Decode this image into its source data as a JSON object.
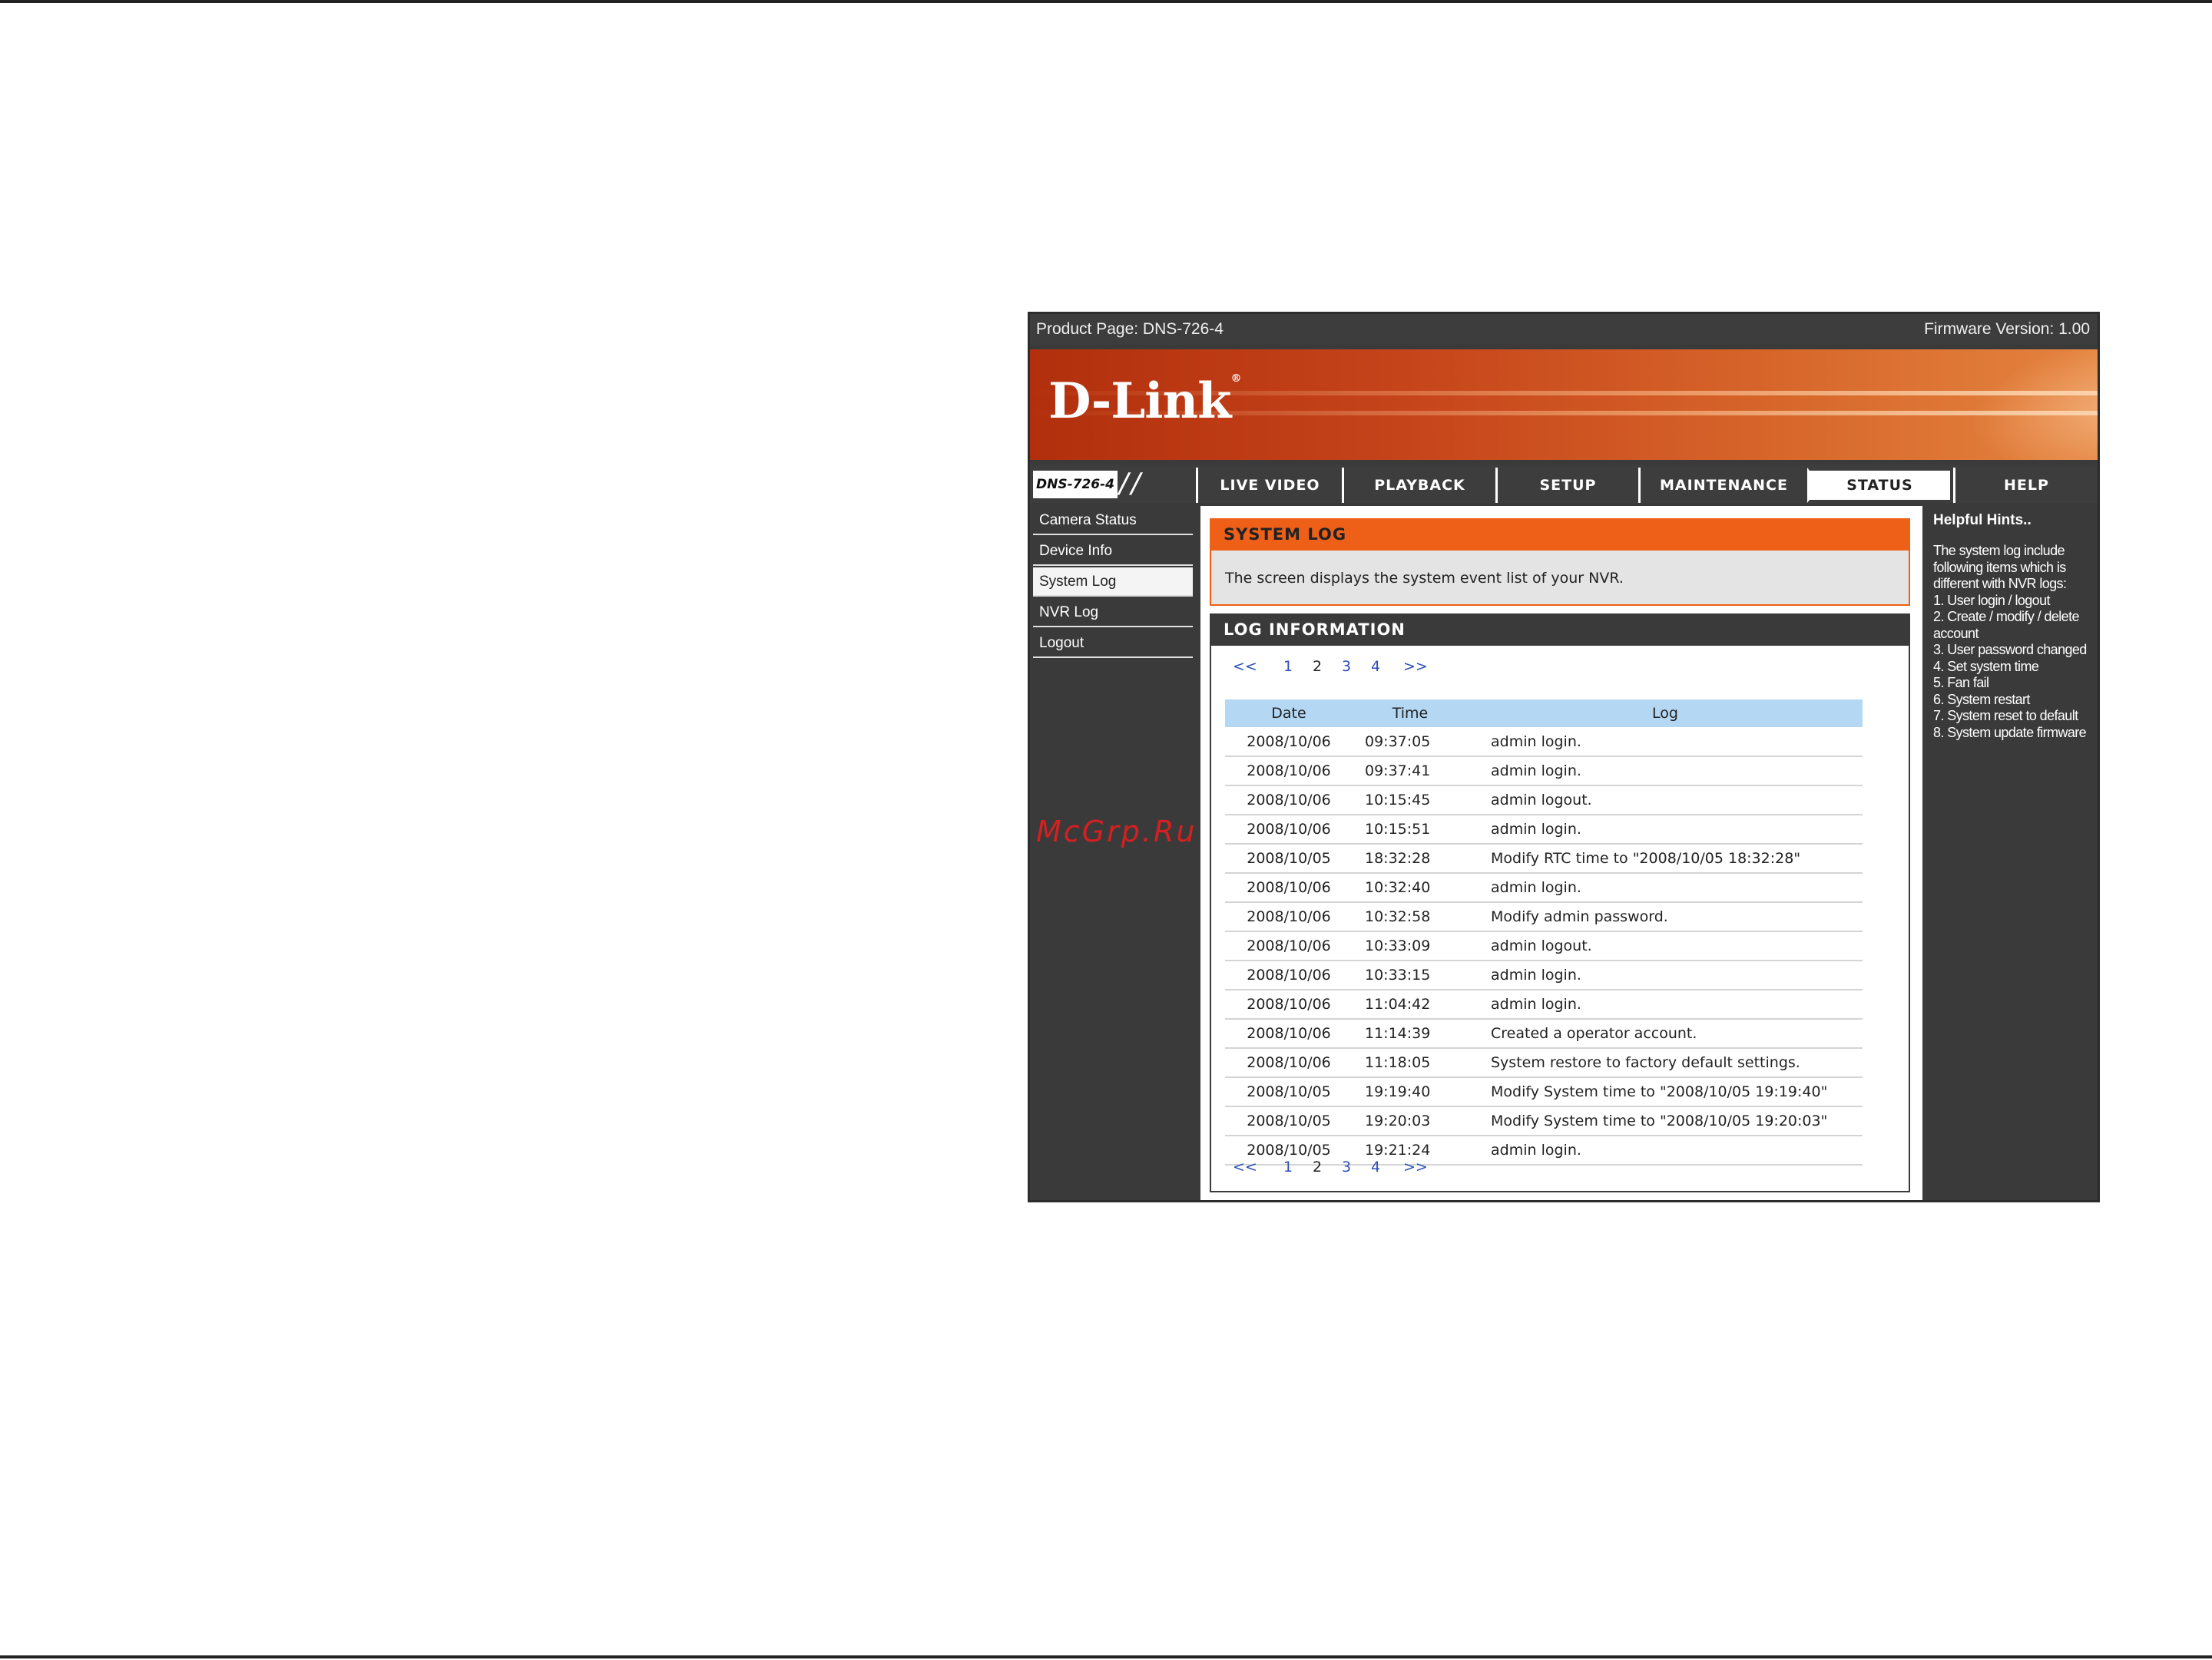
{
  "topbar": {
    "product_page": "Product Page: DNS-726-4",
    "firmware": "Firmware Version: 1.00"
  },
  "brand": {
    "logo_text": "D-Link",
    "logo_mark": "®",
    "model_badge": "DNS-726-4",
    "accent": "#ee6018"
  },
  "nav": {
    "tabs": [
      {
        "label": "LIVE VIDEO"
      },
      {
        "label": "PLAYBACK"
      },
      {
        "label": "SETUP"
      },
      {
        "label": "MAINTENANCE"
      },
      {
        "label": "STATUS"
      },
      {
        "label": "HELP"
      }
    ],
    "active": "STATUS"
  },
  "sidebar": {
    "items": [
      {
        "label": "Camera Status"
      },
      {
        "label": "Device Info"
      },
      {
        "label": "System Log"
      },
      {
        "label": "NVR Log"
      },
      {
        "label": "Logout"
      }
    ],
    "active": "System Log"
  },
  "watermark": "McGrp.Ru",
  "system_log": {
    "title": "SYSTEM LOG",
    "description": "The screen displays the system event list of your NVR."
  },
  "log_info": {
    "title": "LOG INFORMATION",
    "pager": {
      "first": "<<",
      "pages": [
        "1",
        "2",
        "3",
        "4"
      ],
      "current": "2",
      "last": ">>"
    },
    "columns": [
      "Date",
      "Time",
      "Log"
    ],
    "rows": [
      [
        "2008/10/06",
        "09:37:05",
        "admin login."
      ],
      [
        "2008/10/06",
        "09:37:41",
        "admin login."
      ],
      [
        "2008/10/06",
        "10:15:45",
        "admin logout."
      ],
      [
        "2008/10/06",
        "10:15:51",
        "admin login."
      ],
      [
        "2008/10/05",
        "18:32:28",
        "Modify RTC time to \"2008/10/05 18:32:28\""
      ],
      [
        "2008/10/06",
        "10:32:40",
        "admin login."
      ],
      [
        "2008/10/06",
        "10:32:58",
        "Modify admin password."
      ],
      [
        "2008/10/06",
        "10:33:09",
        "admin logout."
      ],
      [
        "2008/10/06",
        "10:33:15",
        "admin login."
      ],
      [
        "2008/10/06",
        "11:04:42",
        "admin login."
      ],
      [
        "2008/10/06",
        "11:14:39",
        "Created a operator account."
      ],
      [
        "2008/10/06",
        "11:18:05",
        "System restore to factory default settings."
      ],
      [
        "2008/10/05",
        "19:19:40",
        "Modify System time to \"2008/10/05 19:19:40\""
      ],
      [
        "2008/10/05",
        "19:20:03",
        "Modify System time to \"2008/10/05 19:20:03\""
      ],
      [
        "2008/10/05",
        "19:21:24",
        "admin login."
      ]
    ]
  },
  "hints": {
    "title": "Helpful Hints..",
    "lines": [
      "The system log include",
      "following items which is",
      "different with NVR logs:",
      "1. User login / logout",
      "2. Create / modify / delete",
      "account",
      "3. User password changed",
      "4. Set system time",
      "5. Fan fail",
      "6. System restart",
      "7. System reset to default",
      "8. System update firmware"
    ]
  }
}
